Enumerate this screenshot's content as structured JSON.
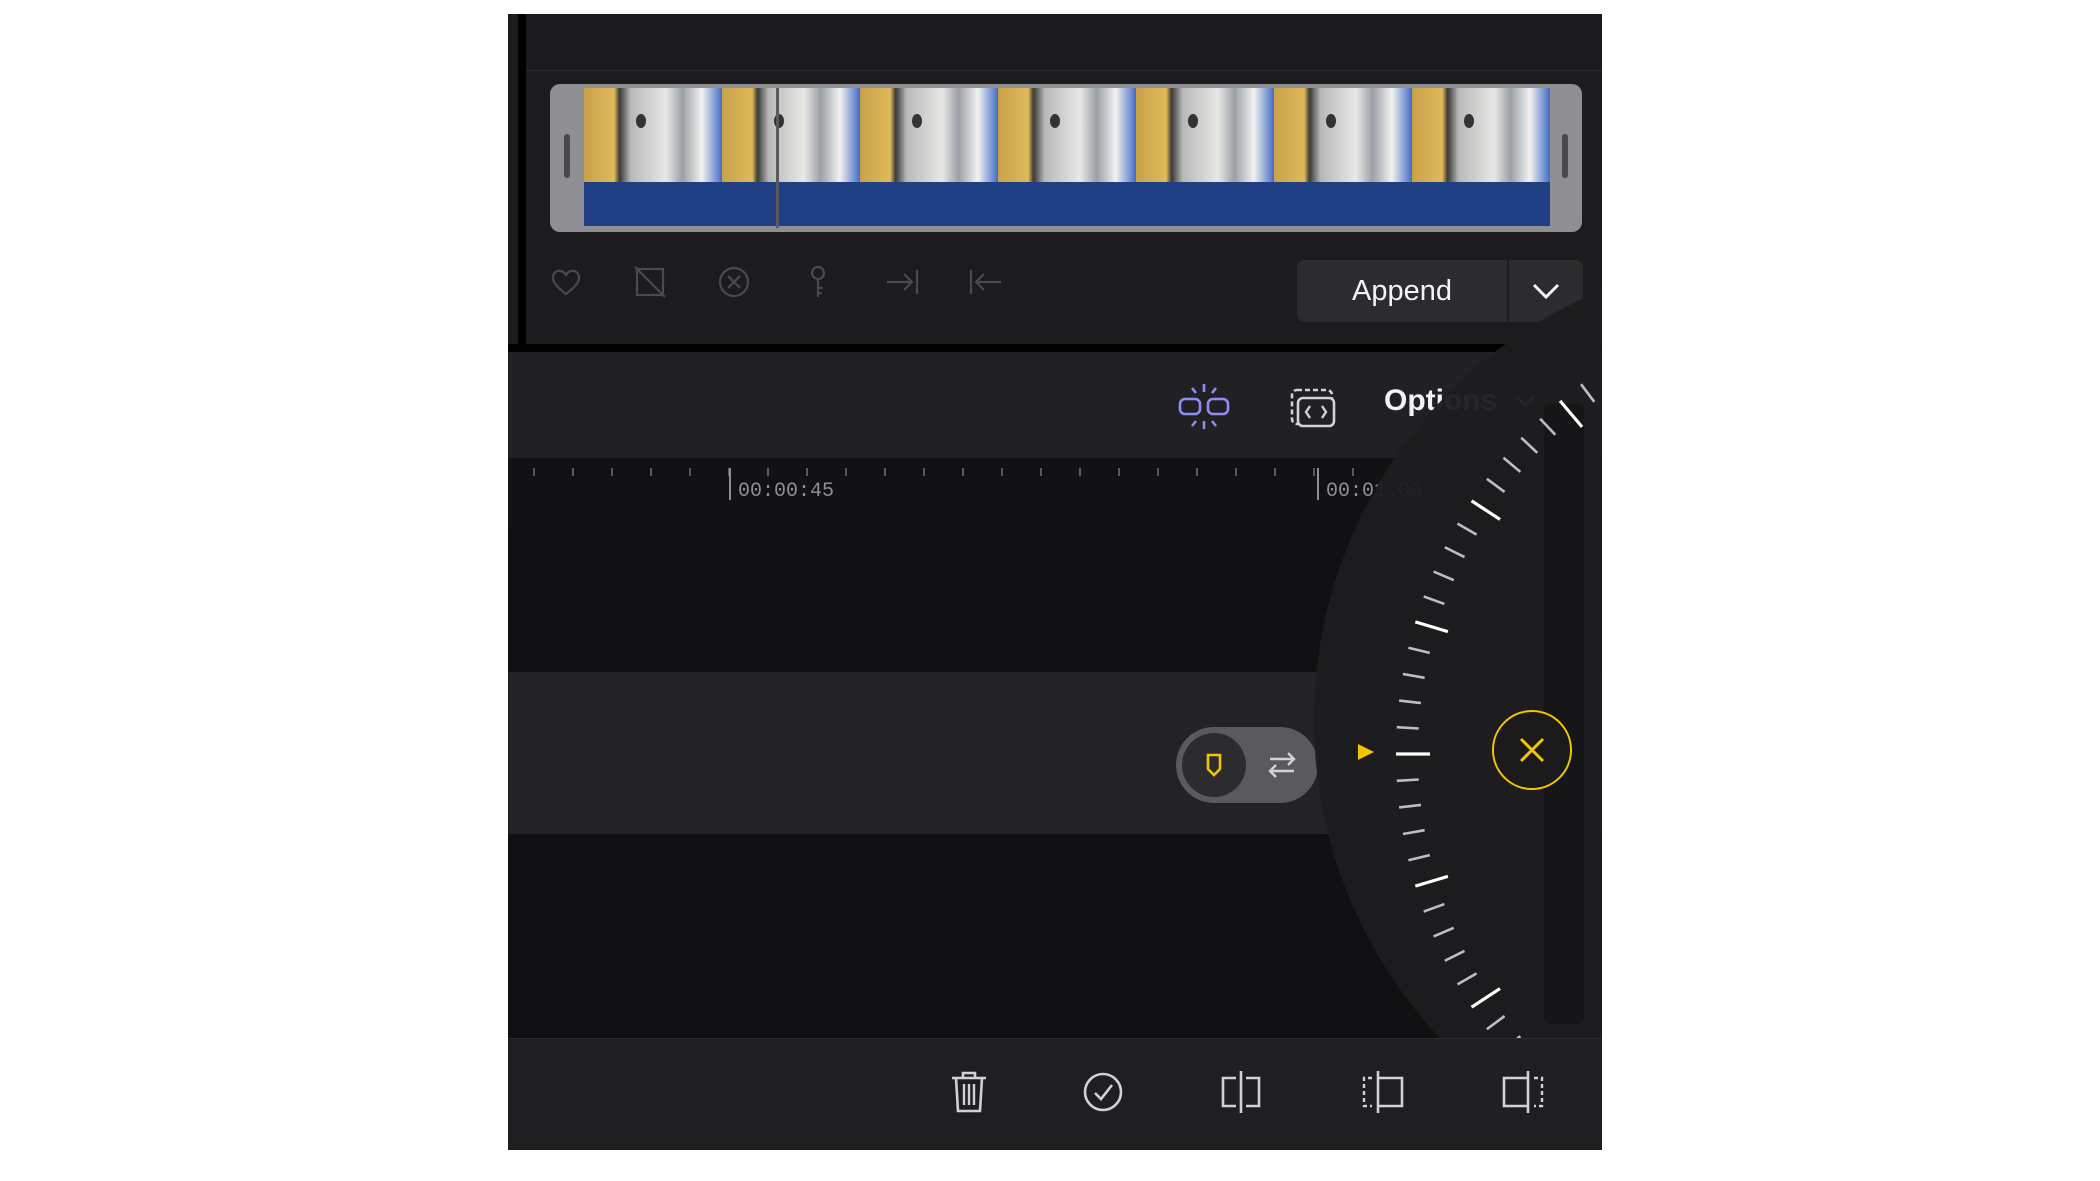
{
  "browser": {
    "append_label": "Append"
  },
  "toolbar": {
    "options_label": "Options"
  },
  "ruler": {
    "labels": [
      "00:00:45",
      "00:01:00"
    ]
  },
  "colors": {
    "accent_yellow": "#f5c400",
    "audio_blue": "#213f85",
    "snap_icon_purple": "#8e8cf5"
  },
  "icons": {
    "browser_tools": [
      "heart-icon",
      "reject-icon",
      "clear-icon",
      "keyword-icon",
      "mark-in-icon",
      "mark-out-icon"
    ],
    "bottom_tools": [
      "trash-icon",
      "checkmark-icon",
      "split-icon",
      "trim-start-icon",
      "trim-end-icon"
    ]
  }
}
